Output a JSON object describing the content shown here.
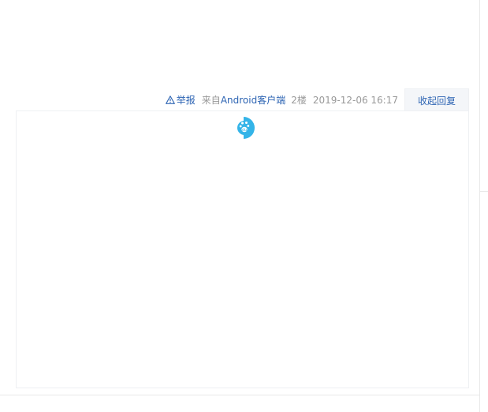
{
  "post_tail": {
    "report_label": "举报",
    "from_prefix": "来自",
    "client_name": "Android客户端",
    "floor": "2楼",
    "timestamp": "2019-12-06 16:17",
    "collapse_label": "收起回复"
  },
  "reply_panel": {
    "loading_icon": "baidu-paw-icon",
    "accent_color": "#2d64b3",
    "logo_color": "#34b4e8"
  }
}
